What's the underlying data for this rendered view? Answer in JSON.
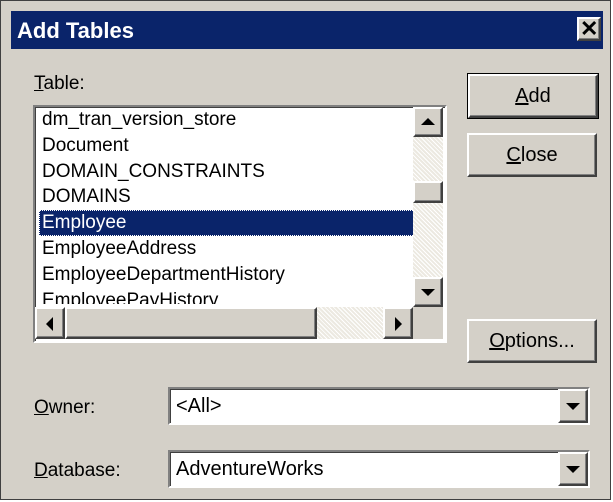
{
  "window": {
    "title": "Add Tables"
  },
  "table_section": {
    "label_first": "T",
    "label_rest": "able:",
    "items": [
      "dm_tran_version_store",
      "Document",
      "DOMAIN_CONSTRAINTS",
      "DOMAINS",
      "Employee",
      "EmployeeAddress",
      "EmployeeDepartmentHistory",
      "EmployeePayHistory"
    ],
    "selected_index": 4
  },
  "buttons": {
    "add_first": "A",
    "add_rest": "dd",
    "close_first": "C",
    "close_rest": "lose",
    "options_first": "O",
    "options_rest": "ptions..."
  },
  "owner": {
    "label_first": "O",
    "label_rest": "wner:",
    "value": "<All>"
  },
  "database": {
    "label_first": "D",
    "label_rest": "atabase:",
    "value": "AdventureWorks"
  },
  "colors": {
    "titlebar": "#0a246a",
    "face": "#d4d0c8",
    "selection": "#0a246a"
  }
}
